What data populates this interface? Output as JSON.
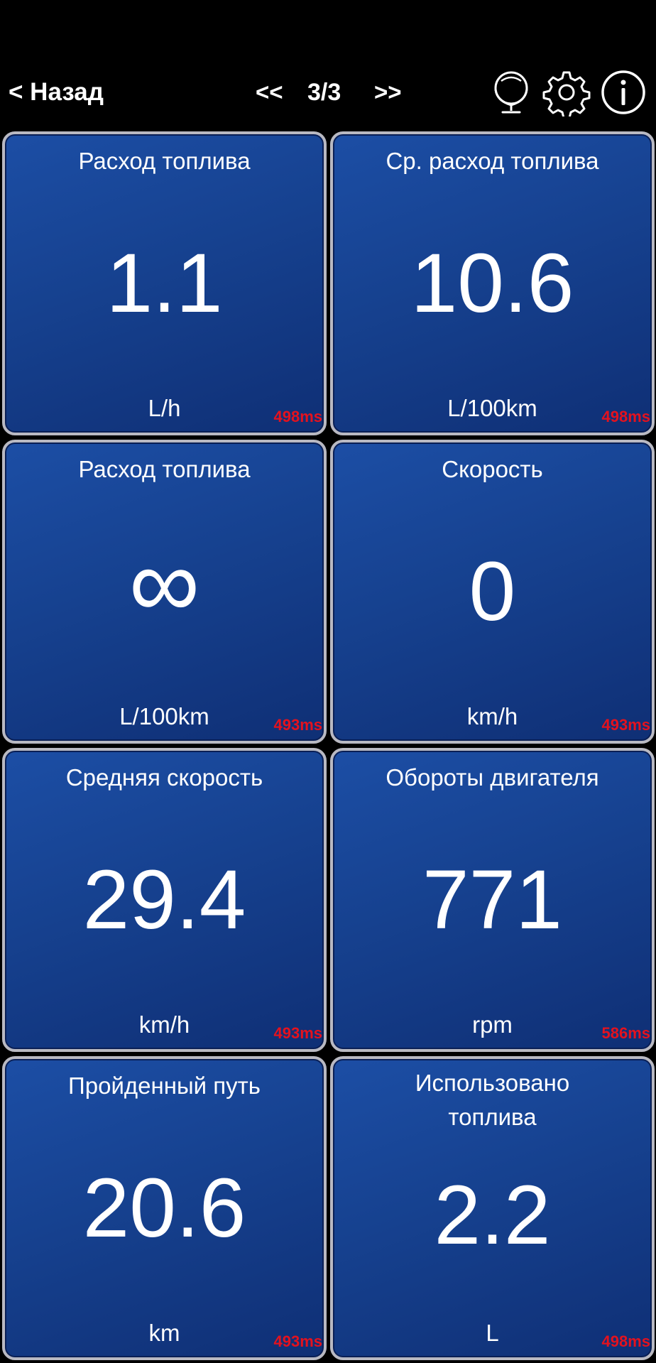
{
  "header": {
    "back_label": "< Назад",
    "prev_label": "<<",
    "page_indicator": "3/3",
    "next_label": ">>",
    "icons": [
      "globe-icon",
      "gear-icon",
      "info-icon"
    ]
  },
  "tiles": [
    {
      "title": "Расход топлива",
      "value": "1.1",
      "unit": "L/h",
      "time": "498ms"
    },
    {
      "title": "Ср. расход топлива",
      "value": "10.6",
      "unit": "L/100km",
      "time": "498ms"
    },
    {
      "title": "Расход топлива",
      "value": "∞",
      "unit": "L/100km",
      "time": "493ms"
    },
    {
      "title": "Скорость",
      "value": "0",
      "unit": "km/h",
      "time": "493ms"
    },
    {
      "title": "Средняя скорость",
      "value": "29.4",
      "unit": "km/h",
      "time": "493ms"
    },
    {
      "title": "Обороты двигателя",
      "value": "771",
      "unit": "rpm",
      "time": "586ms"
    },
    {
      "title": "Пройденный путь",
      "value": "20.6",
      "unit": "km",
      "time": "493ms"
    },
    {
      "title": "Использовано топлива",
      "value": "2.2",
      "unit": "L",
      "time": "498ms"
    }
  ],
  "colors": {
    "tile_gradient_start": "#1c4ea5",
    "tile_gradient_end": "#0f2f75",
    "tile_border": "#b9b9c2",
    "latency_text": "#e4121e",
    "background": "#000000"
  }
}
